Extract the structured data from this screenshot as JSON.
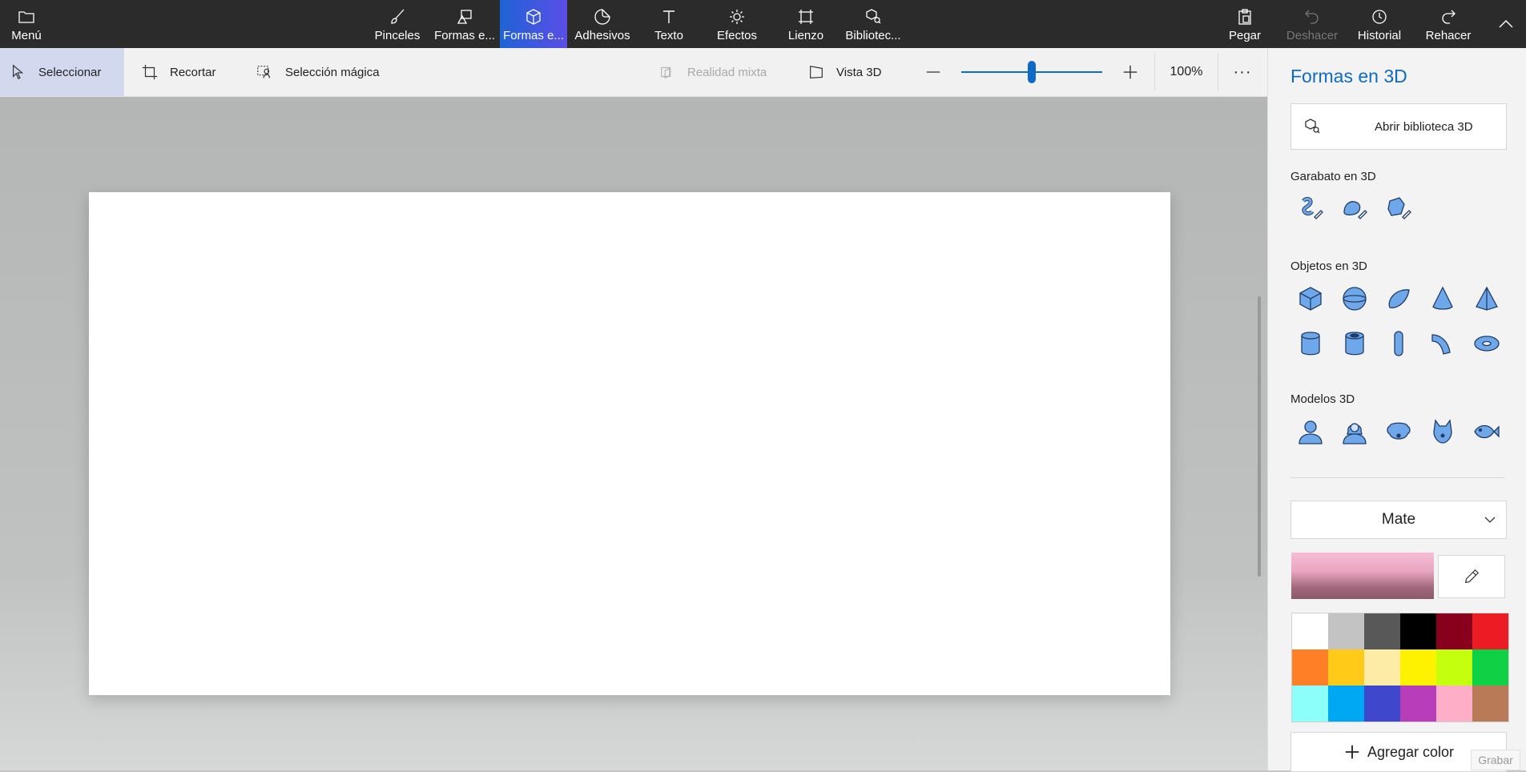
{
  "topbar": {
    "menu": "Menú",
    "tabs": [
      {
        "label": "Pinceles",
        "icon": "brush-icon"
      },
      {
        "label": "Formas e...",
        "icon": "2d-shapes-icon"
      },
      {
        "label": "Formas e...",
        "icon": "3d-cube-icon"
      },
      {
        "label": "Adhesivos",
        "icon": "sticker-icon"
      },
      {
        "label": "Texto",
        "icon": "text-icon"
      },
      {
        "label": "Efectos",
        "icon": "sun-icon"
      },
      {
        "label": "Lienzo",
        "icon": "canvas-icon"
      },
      {
        "label": "Bibliotec...",
        "icon": "3d-library-icon"
      }
    ],
    "actions": [
      {
        "label": "Pegar",
        "icon": "paste-icon"
      },
      {
        "label": "Deshacer",
        "icon": "undo-icon"
      },
      {
        "label": "Historial",
        "icon": "history-icon"
      },
      {
        "label": "Rehacer",
        "icon": "redo-icon"
      }
    ]
  },
  "toolbar": {
    "select": "Seleccionar",
    "crop": "Recortar",
    "magic_select": "Selección mágica",
    "mixed_reality": "Realidad mixta",
    "view_3d": "Vista 3D",
    "zoom": "100%",
    "zoom_slider_fraction": 0.5
  },
  "panel": {
    "title": "Formas en 3D",
    "open_library": "Abrir biblioteca 3D",
    "doodle_label": "Garabato en 3D",
    "objects_label": "Objetos en 3D",
    "models_label": "Modelos 3D",
    "material": "Mate",
    "add_color": "Agregar color",
    "current_color": "#e8a6c0",
    "palette": [
      "#ffffff",
      "#c3c3c3",
      "#585858",
      "#000000",
      "#88001b",
      "#ec1c24",
      "#ff7f27",
      "#ffca18",
      "#fdeca6",
      "#fff200",
      "#c4ff0e",
      "#0ed145",
      "#8cfffb",
      "#00a8f3",
      "#3f48cc",
      "#b83dba",
      "#ffaec8",
      "#b97a57"
    ]
  },
  "record": "Grabar"
}
